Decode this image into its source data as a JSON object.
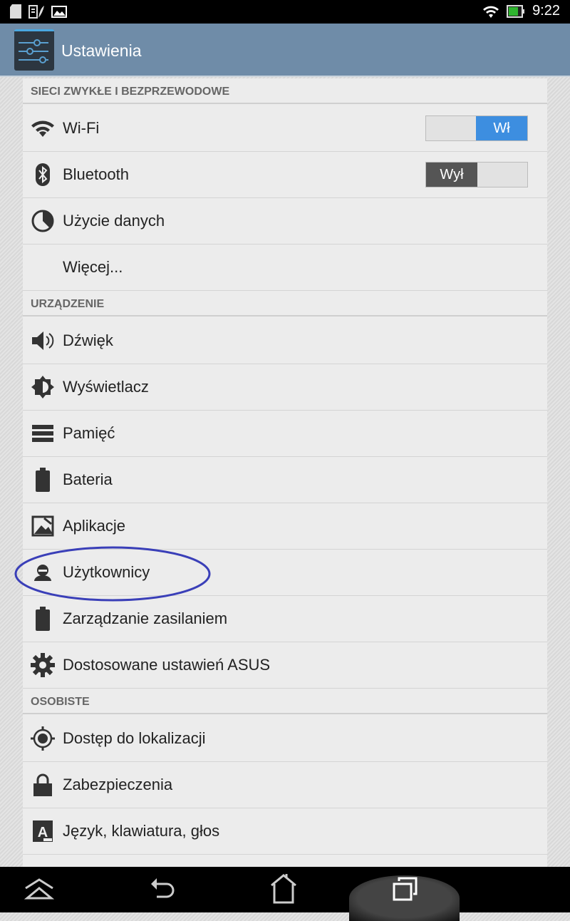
{
  "status_bar": {
    "time": "9:22",
    "icons": [
      "sd-card-icon",
      "battery-saver-icon",
      "image-icon",
      "wifi-icon",
      "battery-icon"
    ],
    "battery_color": "#2fb52f"
  },
  "action_bar": {
    "title": "Ustawienia",
    "icon": "settings-sliders-icon"
  },
  "sections": [
    {
      "header": "SIECI ZWYKŁE I BEZPRZEWODOWE",
      "items": [
        {
          "label": "Wi-Fi",
          "icon": "wifi-icon",
          "toggle": "Wł",
          "toggle_on": true
        },
        {
          "label": "Bluetooth",
          "icon": "bluetooth-icon",
          "toggle": "Wył",
          "toggle_on": false
        },
        {
          "label": "Użycie danych",
          "icon": "data-usage-icon"
        },
        {
          "label": "Więcej...",
          "icon": ""
        }
      ]
    },
    {
      "header": "URZĄDZENIE",
      "items": [
        {
          "label": "Dźwięk",
          "icon": "speaker-icon"
        },
        {
          "label": "Wyświetlacz",
          "icon": "brightness-icon"
        },
        {
          "label": "Pamięć",
          "icon": "storage-icon"
        },
        {
          "label": "Bateria",
          "icon": "battery-icon"
        },
        {
          "label": "Aplikacje",
          "icon": "apps-icon"
        },
        {
          "label": "Użytkownicy",
          "icon": "user-icon",
          "highlighted": true
        },
        {
          "label": "Zarządzanie zasilaniem",
          "icon": "battery-icon"
        },
        {
          "label": "Dostosowane ustawień ASUS",
          "icon": "gear-icon"
        }
      ]
    },
    {
      "header": "OSOBISTE",
      "items": [
        {
          "label": "Dostęp do lokalizacji",
          "icon": "location-icon"
        },
        {
          "label": "Zabezpieczenia",
          "icon": "lock-icon"
        },
        {
          "label": "Język, klawiatura, głos",
          "icon": "language-icon"
        }
      ]
    }
  ],
  "nav_bar": [
    "up-icon",
    "back-icon",
    "home-icon",
    "recent-apps-icon"
  ],
  "colors": {
    "accent": "#3d8ee0",
    "action_bar": "#6f8ca8",
    "annotation": "#3a3fb8"
  }
}
